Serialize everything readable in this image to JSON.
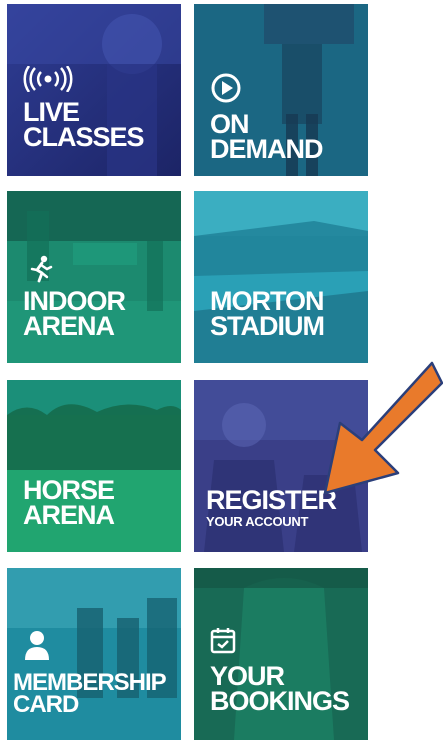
{
  "tiles": [
    {
      "line1": "LIVE",
      "line2": "CLASSES",
      "sub": "",
      "icon": "broadcast-icon",
      "color": "#26307a"
    },
    {
      "line1": "ON",
      "line2": "DEMAND",
      "sub": "",
      "icon": "play-circle-icon",
      "color": "#1d5f7f"
    },
    {
      "line1": "INDOOR",
      "line2": "ARENA",
      "sub": "",
      "icon": "runner-icon",
      "color": "#1c8a6f"
    },
    {
      "line1": "MORTON",
      "line2": "STADIUM",
      "sub": "",
      "icon": "",
      "color": "#2aa0b6"
    },
    {
      "line1": "HORSE",
      "line2": "ARENA",
      "sub": "",
      "icon": "",
      "color": "#1e9a6a"
    },
    {
      "line1": "REGISTER",
      "line2": "",
      "sub": "YOUR ACCOUNT",
      "icon": "",
      "color": "#3a3f88"
    },
    {
      "line1": "MEMBERSHIP",
      "line2": "CARD",
      "sub": "",
      "icon": "person-icon",
      "color": "#1f8ca0"
    },
    {
      "line1": "YOUR",
      "line2": "BOOKINGS",
      "sub": "",
      "icon": "calendar-check-icon",
      "color": "#186a55"
    }
  ],
  "arrow": {
    "color": "#e97a2b",
    "outline": "#2b3f7a",
    "icon": "arrow-pointer-icon"
  }
}
